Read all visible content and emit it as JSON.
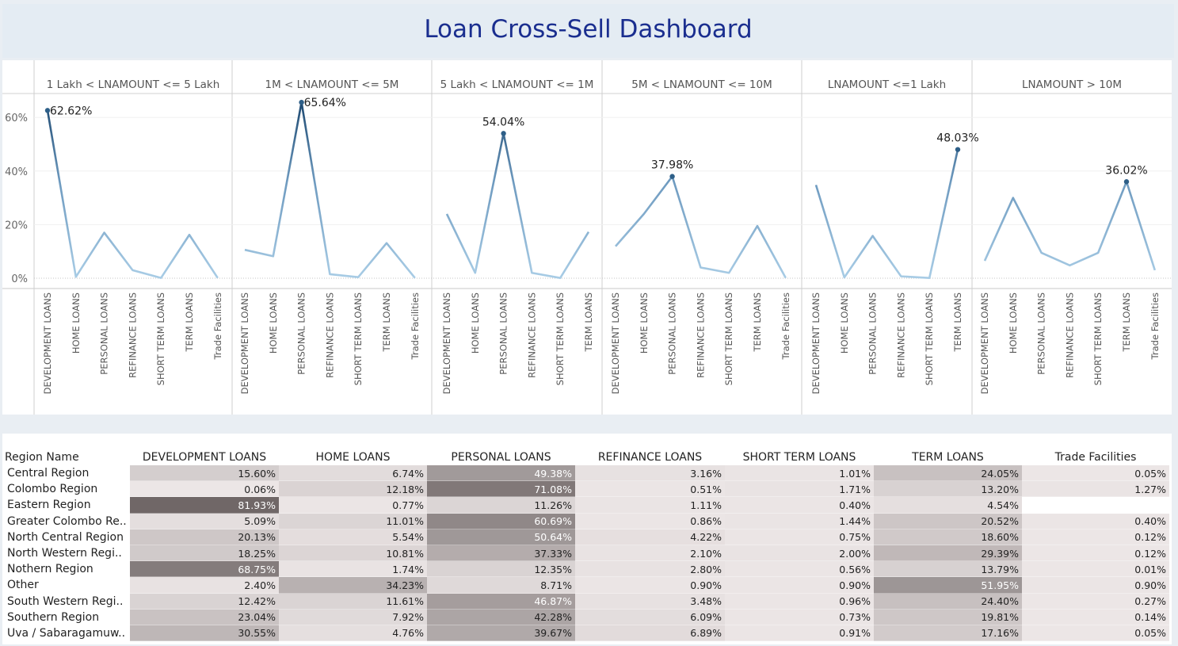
{
  "dashboard": {
    "title": "Loan Cross-Sell Dashboard"
  },
  "chart_data": {
    "type": "line",
    "y_ticks": [
      "60%",
      "40%",
      "20%",
      "0%"
    ],
    "ylim": [
      0,
      70
    ],
    "panels": [
      {
        "header": "1 Lakh < LNAMOUNT <= 5 Lakh",
        "categories": [
          "DEVELOPMENT LOANS",
          "HOME LOANS",
          "PERSONAL LOANS",
          "REFINANCE LOANS",
          "SHORT TERM LOANS",
          "TERM LOANS",
          "Trade Facilities"
        ],
        "values": [
          62.62,
          0.5,
          17.0,
          3.0,
          0.1,
          16.2,
          0.1
        ],
        "peak_label": "62.62%"
      },
      {
        "header": "1M < LNAMOUNT <= 5M",
        "categories": [
          "DEVELOPMENT LOANS",
          "HOME LOANS",
          "PERSONAL LOANS",
          "REFINANCE LOANS",
          "SHORT TERM LOANS",
          "TERM LOANS",
          "Trade Facilities"
        ],
        "values": [
          10.6,
          8.2,
          65.64,
          1.5,
          0.4,
          13.1,
          0.1
        ],
        "peak_label": "65.64%"
      },
      {
        "header": "5 Lakh < LNAMOUNT <= 1M",
        "categories": [
          "DEVELOPMENT LOANS",
          "HOME LOANS",
          "PERSONAL LOANS",
          "REFINANCE LOANS",
          "SHORT TERM LOANS",
          "TERM LOANS"
        ],
        "values": [
          24.0,
          2.0,
          54.04,
          2.0,
          0.1,
          17.3
        ],
        "peak_label": "54.04%"
      },
      {
        "header": "5M < LNAMOUNT <= 10M",
        "categories": [
          "DEVELOPMENT LOANS",
          "HOME LOANS",
          "PERSONAL LOANS",
          "REFINANCE LOANS",
          "SHORT TERM LOANS",
          "TERM LOANS",
          "Trade Facilities"
        ],
        "values": [
          11.9,
          24.0,
          37.98,
          4.0,
          2.0,
          19.5,
          0.1
        ],
        "peak_label": "37.98%"
      },
      {
        "header": "LNAMOUNT <=1 Lakh",
        "categories": [
          "DEVELOPMENT LOANS",
          "HOME LOANS",
          "PERSONAL LOANS",
          "REFINANCE LOANS",
          "SHORT TERM LOANS",
          "TERM LOANS"
        ],
        "values": [
          34.8,
          0.3,
          15.8,
          0.7,
          0.1,
          48.03
        ],
        "peak_label": "48.03%"
      },
      {
        "header": "LNAMOUNT > 10M",
        "categories": [
          "DEVELOPMENT LOANS",
          "HOME LOANS",
          "PERSONAL LOANS",
          "REFINANCE LOANS",
          "SHORT TERM LOANS",
          "TERM LOANS",
          "Trade Facilities"
        ],
        "values": [
          6.5,
          30.0,
          9.5,
          4.8,
          9.5,
          36.02,
          3.0
        ],
        "peak_label": "36.02%"
      }
    ]
  },
  "table": {
    "row_header": "Region Name",
    "columns": [
      "DEVELOPMENT LOANS",
      "HOME LOANS",
      "PERSONAL LOANS",
      "REFINANCE LOANS",
      "SHORT TERM LOANS",
      "TERM LOANS",
      "Trade Facilities"
    ],
    "rows": [
      {
        "name": "Central Region",
        "cells": [
          "15.60%",
          "6.74%",
          "49.38%",
          "3.16%",
          "1.01%",
          "24.05%",
          "0.05%"
        ]
      },
      {
        "name": "Colombo Region",
        "cells": [
          "0.06%",
          "12.18%",
          "71.08%",
          "0.51%",
          "1.71%",
          "13.20%",
          "1.27%"
        ]
      },
      {
        "name": "Eastern Region",
        "cells": [
          "81.93%",
          "0.77%",
          "11.26%",
          "1.11%",
          "0.40%",
          "4.54%",
          ""
        ]
      },
      {
        "name": "Greater Colombo Re..",
        "cells": [
          "5.09%",
          "11.01%",
          "60.69%",
          "0.86%",
          "1.44%",
          "20.52%",
          "0.40%"
        ]
      },
      {
        "name": "North Central Region",
        "cells": [
          "20.13%",
          "5.54%",
          "50.64%",
          "4.22%",
          "0.75%",
          "18.60%",
          "0.12%"
        ]
      },
      {
        "name": "North Western Regi..",
        "cells": [
          "18.25%",
          "10.81%",
          "37.33%",
          "2.10%",
          "2.00%",
          "29.39%",
          "0.12%"
        ]
      },
      {
        "name": "Nothern Region",
        "cells": [
          "68.75%",
          "1.74%",
          "12.35%",
          "2.80%",
          "0.56%",
          "13.79%",
          "0.01%"
        ]
      },
      {
        "name": "Other",
        "cells": [
          "2.40%",
          "34.23%",
          "8.71%",
          "0.90%",
          "0.90%",
          "51.95%",
          "0.90%"
        ]
      },
      {
        "name": "South Western Regi..",
        "cells": [
          "12.42%",
          "11.61%",
          "46.87%",
          "3.48%",
          "0.96%",
          "24.40%",
          "0.27%"
        ]
      },
      {
        "name": "Southern Region",
        "cells": [
          "23.04%",
          "7.92%",
          "42.28%",
          "6.09%",
          "0.73%",
          "19.81%",
          "0.14%"
        ]
      },
      {
        "name": "Uva / Sabaragamuw..",
        "cells": [
          "30.55%",
          "4.76%",
          "39.67%",
          "6.89%",
          "0.91%",
          "17.16%",
          "0.05%"
        ]
      }
    ]
  }
}
